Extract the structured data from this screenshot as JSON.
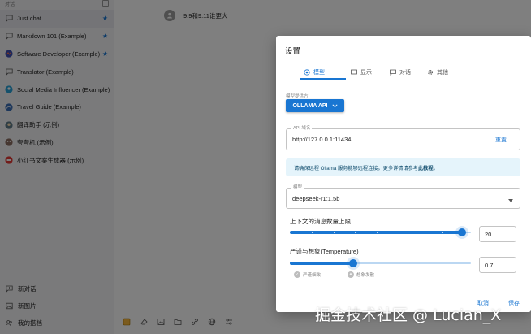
{
  "sidebar": {
    "header_label": "对话",
    "chats": [
      {
        "label": "Just chat",
        "icon": "chat-icon",
        "starred": true,
        "active": true
      },
      {
        "label": "Markdown 101 (Example)",
        "icon": "chat-icon",
        "starred": true
      },
      {
        "label": "Software Developer (Example)",
        "icon": "developer-avatar-icon",
        "starred": true
      },
      {
        "label": "Translator (Example)",
        "icon": "chat-icon",
        "starred": false
      },
      {
        "label": "Social Media Influencer (Example)",
        "icon": "influencer-avatar-icon",
        "starred": false
      },
      {
        "label": "Travel Guide (Example)",
        "icon": "travel-avatar-icon",
        "starred": false
      },
      {
        "label": "翻译助手 (示例)",
        "icon": "translator-avatar-icon",
        "starred": false
      },
      {
        "label": "夸夸机 (示例)",
        "icon": "praise-avatar-icon",
        "starred": false
      },
      {
        "label": "小红书文案生成器 (示例)",
        "icon": "xiaohongshu-avatar-icon",
        "starred": false
      }
    ],
    "bottom": [
      {
        "label": "新对话",
        "icon": "add-chat-icon"
      },
      {
        "label": "新图片",
        "icon": "new-image-icon"
      },
      {
        "label": "我的搭档",
        "icon": "partner-icon"
      }
    ]
  },
  "main": {
    "message_text": "9.9和9.11谁更大"
  },
  "dialog": {
    "title": "设置",
    "tabs": [
      {
        "label": "模型",
        "icon": "model-icon",
        "active": true
      },
      {
        "label": "显示",
        "icon": "display-icon"
      },
      {
        "label": "对话",
        "icon": "chat-bubble-icon"
      },
      {
        "label": "其他",
        "icon": "gear-icon"
      }
    ],
    "provider": {
      "label": "模型提供方",
      "value": "OLLAMA API"
    },
    "api_host": {
      "label": "API 域名",
      "value": "http://127.0.0.1:11434",
      "reset_label": "重置"
    },
    "info": {
      "text": "请确保远程 Ollama 服务能够远程连接。更多详情请参考",
      "link": "此教程",
      "suffix": "。"
    },
    "model": {
      "label": "模型",
      "value": "deepseek-r1:1.5b"
    },
    "context_limit": {
      "label": "上下文的消息数量上限",
      "value": "20",
      "fraction": 0.95
    },
    "temperature": {
      "label": "严谨与想象(Temperature)",
      "value": "0.7",
      "fraction": 0.35,
      "chip_left": "严谨细致",
      "chip_right": "想象发散"
    },
    "actions": {
      "cancel": "取消",
      "save": "保存"
    }
  },
  "watermark": "掘金技术社区 @ Lucian_X",
  "colors": {
    "accent": "#1976d2",
    "info_bg": "#e5f4fb",
    "star": "#1976d2"
  }
}
